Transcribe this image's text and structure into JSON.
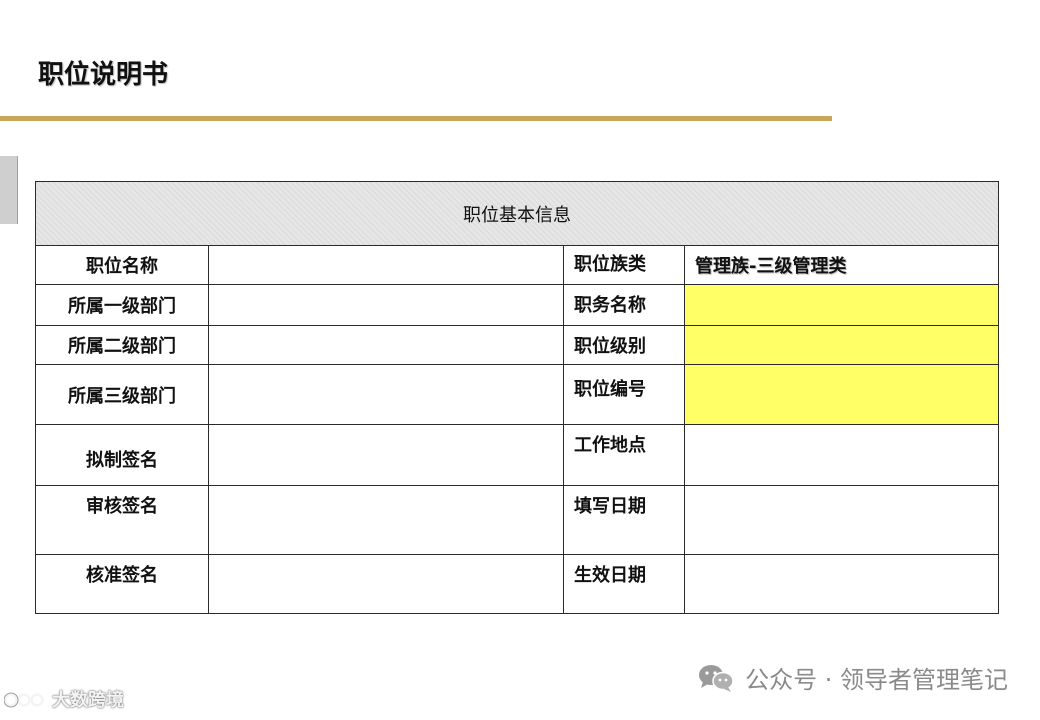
{
  "page": {
    "title": "职位说明书"
  },
  "table": {
    "header": "职位基本信息",
    "rows": [
      {
        "left_label": "职位名称",
        "left_value": "",
        "right_label": "职位族类",
        "right_value": "管理族-三级管理类"
      },
      {
        "left_label": "所属一级部门",
        "left_value": "",
        "right_label": "职务名称",
        "right_value": ""
      },
      {
        "left_label": "所属二级部门",
        "left_value": "",
        "right_label": "职位级别",
        "right_value": ""
      },
      {
        "left_label": "所属三级部门",
        "left_value": "",
        "right_label": "职位编号",
        "right_value": ""
      },
      {
        "left_label": "拟制签名",
        "left_value": "",
        "right_label": "工作地点",
        "right_value": ""
      },
      {
        "left_label": "审核签名",
        "left_value": "",
        "right_label": "填写日期",
        "right_value": ""
      },
      {
        "left_label": "核准签名",
        "left_value": "",
        "right_label": "生效日期",
        "right_value": ""
      }
    ]
  },
  "colors": {
    "accent_rule": "#c9a75a",
    "highlight_yellow": "#ffff66"
  },
  "watermark": {
    "icon": "wechat-icon",
    "text": "公众号 · 领导者管理笔记"
  },
  "brand": {
    "icon": "brand-logo-icon",
    "text": "大数跨境"
  }
}
